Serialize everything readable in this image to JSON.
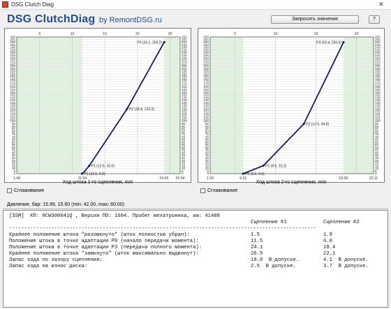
{
  "window": {
    "title": "DSG Clutch Diag",
    "close_glyph": "✕"
  },
  "header": {
    "brand": "DSG ClutchDiag",
    "brand_sub": "by RemontDSG.ru",
    "read_button": "Запросить значения",
    "help_button": "?"
  },
  "colors": {
    "brand": "#1f4f8f",
    "green_zone": "#dff3df",
    "curve": "#1a1a55"
  },
  "chart_data": [
    {
      "type": "line",
      "xlabel": "Ход штока 1-го сцепления, mm",
      "xlim": [
        1.49,
        26.54
      ],
      "ylim": [
        0,
        260
      ],
      "top_ticks": [
        "5",
        "10",
        "15",
        "20",
        "25"
      ],
      "bottom_ticks": [
        "1.49",
        "11.54",
        "24.06",
        "26.54"
      ],
      "y_ticks": [
        "0",
        "5",
        "10",
        "15",
        "20",
        "25",
        "30",
        "35",
        "40",
        "45",
        "50",
        "55",
        "60",
        "65",
        "70",
        "75",
        "80",
        "85",
        "90",
        "95",
        "100",
        "105",
        "110",
        "115",
        "120",
        "125",
        "130",
        "135",
        "140",
        "145",
        "150",
        "155",
        "160",
        "165",
        "170",
        "175",
        "180",
        "185",
        "190",
        "195",
        "200",
        "205",
        "210",
        "215",
        "220",
        "225",
        "230",
        "235",
        "240",
        "245",
        "250",
        "255",
        "260"
      ],
      "green_zones": [
        [
          1.49,
          11.54
        ],
        [
          24.06,
          26.54
        ]
      ],
      "series": [
        {
          "x": [
            11.5,
            11.7,
            12.6,
            18.4,
            24.1
          ],
          "y": [
            0,
            2.0,
            15.0,
            123.3,
            250.2
          ]
        }
      ],
      "points": [
        {
          "label": "P1 (11.5, 0.0)",
          "x": 11.5,
          "y": 0
        },
        {
          "label": "P1 (12.6, 15.0)",
          "x": 12.6,
          "y": 15.0
        },
        {
          "label": "P2 (18.4, 123.3)",
          "x": 18.4,
          "y": 123.3
        },
        {
          "label": "P3 (24.1, 250.2)",
          "x": 24.1,
          "y": 250.2
        }
      ],
      "checkbox": "Сглаживание"
    },
    {
      "type": "line",
      "xlabel": "Ход штока 2-го сцепления, mm",
      "xlim": [
        1.93,
        22.11
      ],
      "ylim": [
        0,
        260
      ],
      "top_ticks": [
        "5",
        "10",
        "15",
        "20"
      ],
      "bottom_ticks": [
        "1.93",
        "6.01",
        "18.38",
        "22.11"
      ],
      "y_ticks": [
        "0",
        "5",
        "10",
        "15",
        "20",
        "25",
        "30",
        "35",
        "40",
        "45",
        "50",
        "55",
        "60",
        "65",
        "70",
        "75",
        "80",
        "85",
        "90",
        "95",
        "100",
        "105",
        "110",
        "115",
        "120",
        "125",
        "130",
        "135",
        "140",
        "145",
        "150",
        "155",
        "160",
        "165",
        "170",
        "175",
        "180",
        "185",
        "190",
        "195",
        "200",
        "205",
        "210",
        "215",
        "220",
        "225",
        "230",
        "235",
        "240",
        "245",
        "250",
        "255",
        "260"
      ],
      "green_zones": [
        [
          1.93,
          6.01
        ],
        [
          18.38,
          22.11
        ]
      ],
      "series": [
        {
          "x": [
            6.0,
            6.5,
            8.5,
            13.5,
            18.4
          ],
          "y": [
            0,
            3.0,
            15.2,
            94.8,
            250.0
          ]
        }
      ],
      "points": [
        {
          "label": "P0 (6.0, 0.0)",
          "x": 6.0,
          "y": 0
        },
        {
          "label": "P1 (8.5, 15.2)",
          "x": 8.5,
          "y": 15.2
        },
        {
          "label": "P2 (13.5, 94.8)",
          "x": 13.5,
          "y": 94.8
        },
        {
          "label": "P3 (18.4, 250.0)",
          "x": 18.4,
          "y": 250.0
        }
      ],
      "checkbox": "Сглаживание"
    }
  ],
  "pressure_line": "Давление, бар: 15.99, 15.60 (min: 42.00, max: 60.00)",
  "report": {
    "header": "[SSM]  КП: 0CW300041Q , Версия ПО: 1604. Пробег мехатроника, км: 41408",
    "col_k1": "Сцепление К1",
    "col_k2": "Сцепление К2",
    "divider": "------------------------------------------------------------------------------------------------------",
    "rows": [
      {
        "label": "Крайнее положение штока \"разомкнуто\" (шток полностью убран):",
        "k1": "1.5",
        "k2": "1.9"
      },
      {
        "label": "Положение штока в точке адаптации P0 (начало передачи момента):",
        "k1": "11.5",
        "k2": "6.0"
      },
      {
        "label": "Положение штока в точке адаптации P3 (передача полного момента):",
        "k1": "24.1",
        "k2": "18.4"
      },
      {
        "label": "Крайнее положение штока \"замкнуто\" (шток максимально выдвинут):",
        "k1": "26.5",
        "k2": "22.1"
      },
      {
        "label": "Запас хода по зазору сцепления:",
        "k1": "10.0  В допуске.",
        "k2": "4.1  В допуске."
      },
      {
        "label": "Запас хода на износ диска:",
        "k1": "2.5  В допуске.",
        "k2": "3.7  В допуске."
      }
    ]
  }
}
